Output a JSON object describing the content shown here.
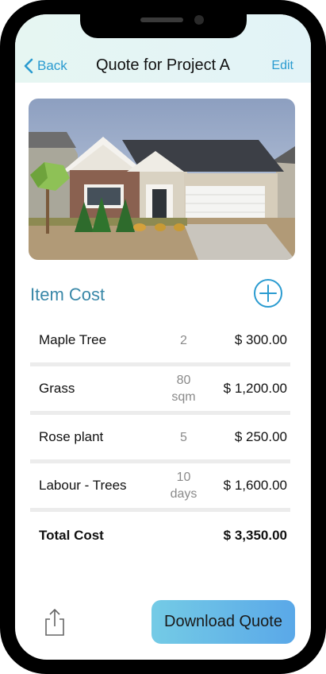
{
  "nav": {
    "back_label": "Back",
    "title": "Quote for Project A",
    "edit_label": "Edit"
  },
  "photo": {
    "alt": "house-with-trees"
  },
  "section": {
    "title": "Item Cost"
  },
  "items": [
    {
      "name": "Maple Tree",
      "qty_line1": "2",
      "qty_line2": "",
      "price": "$ 300.00"
    },
    {
      "name": "Grass",
      "qty_line1": "80",
      "qty_line2": "sqm",
      "price": "$ 1,200.00"
    },
    {
      "name": "Rose plant",
      "qty_line1": "5",
      "qty_line2": "",
      "price": "$ 250.00"
    },
    {
      "name": "Labour - Trees",
      "qty_line1": "10",
      "qty_line2": "days",
      "price": "$ 1,600.00"
    }
  ],
  "total": {
    "label": "Total Cost",
    "value": "$ 3,350.00"
  },
  "footer": {
    "download_label": "Download Quote"
  },
  "colors": {
    "accent": "#2a9bd0",
    "section": "#3a88a8"
  }
}
